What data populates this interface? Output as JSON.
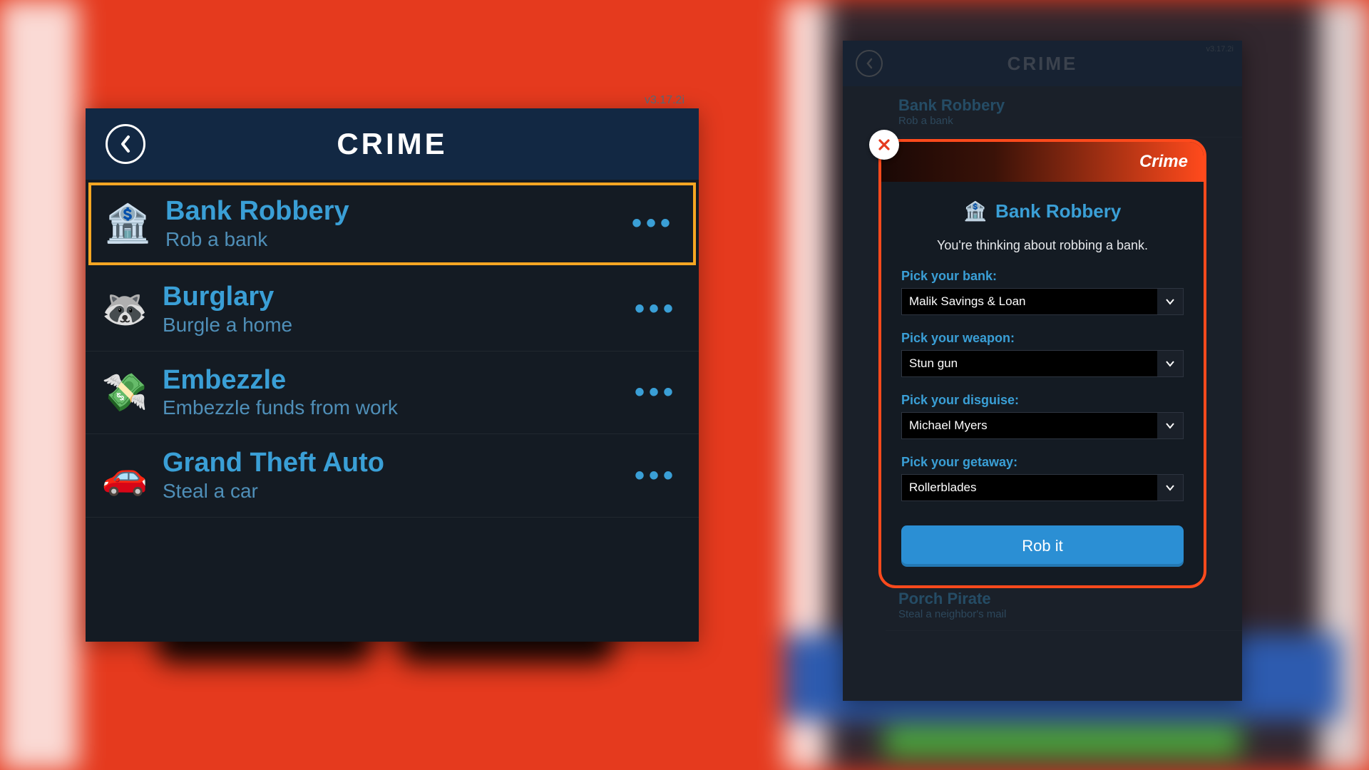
{
  "colors": {
    "background": "#e53a1e",
    "accent_blue": "#3a9fd6",
    "highlight_border": "#f5a623",
    "modal_border": "#ff4a1c"
  },
  "left_panel": {
    "version": "v3.17.2i",
    "title": "CRIME",
    "items": [
      {
        "icon": "🏦",
        "title": "Bank Robbery",
        "subtitle": "Rob a bank",
        "highlighted": true
      },
      {
        "icon": "🦝",
        "title": "Burglary",
        "subtitle": "Burgle a home",
        "highlighted": false
      },
      {
        "icon": "💸",
        "title": "Embezzle",
        "subtitle": "Embezzle funds from work",
        "highlighted": false
      },
      {
        "icon": "🚗",
        "title": "Grand Theft Auto",
        "subtitle": "Steal a car",
        "highlighted": false
      }
    ]
  },
  "right_panel": {
    "version": "v3.17.2i",
    "title": "CRIME",
    "bg_items": [
      {
        "title": "Bank Robbery",
        "subtitle": "Rob a bank"
      },
      {
        "title": "Porch Pirate",
        "subtitle": "Steal a neighbor's mail"
      }
    ],
    "modal": {
      "header": "Crime",
      "icon": "🏦",
      "title": "Bank Robbery",
      "description": "You're thinking about robbing a bank.",
      "fields": [
        {
          "label": "Pick your bank:",
          "value": "Malik Savings & Loan"
        },
        {
          "label": "Pick your weapon:",
          "value": "Stun gun"
        },
        {
          "label": "Pick your disguise:",
          "value": "Michael Myers"
        },
        {
          "label": "Pick your getaway:",
          "value": "Rollerblades"
        }
      ],
      "action_label": "Rob it"
    }
  }
}
